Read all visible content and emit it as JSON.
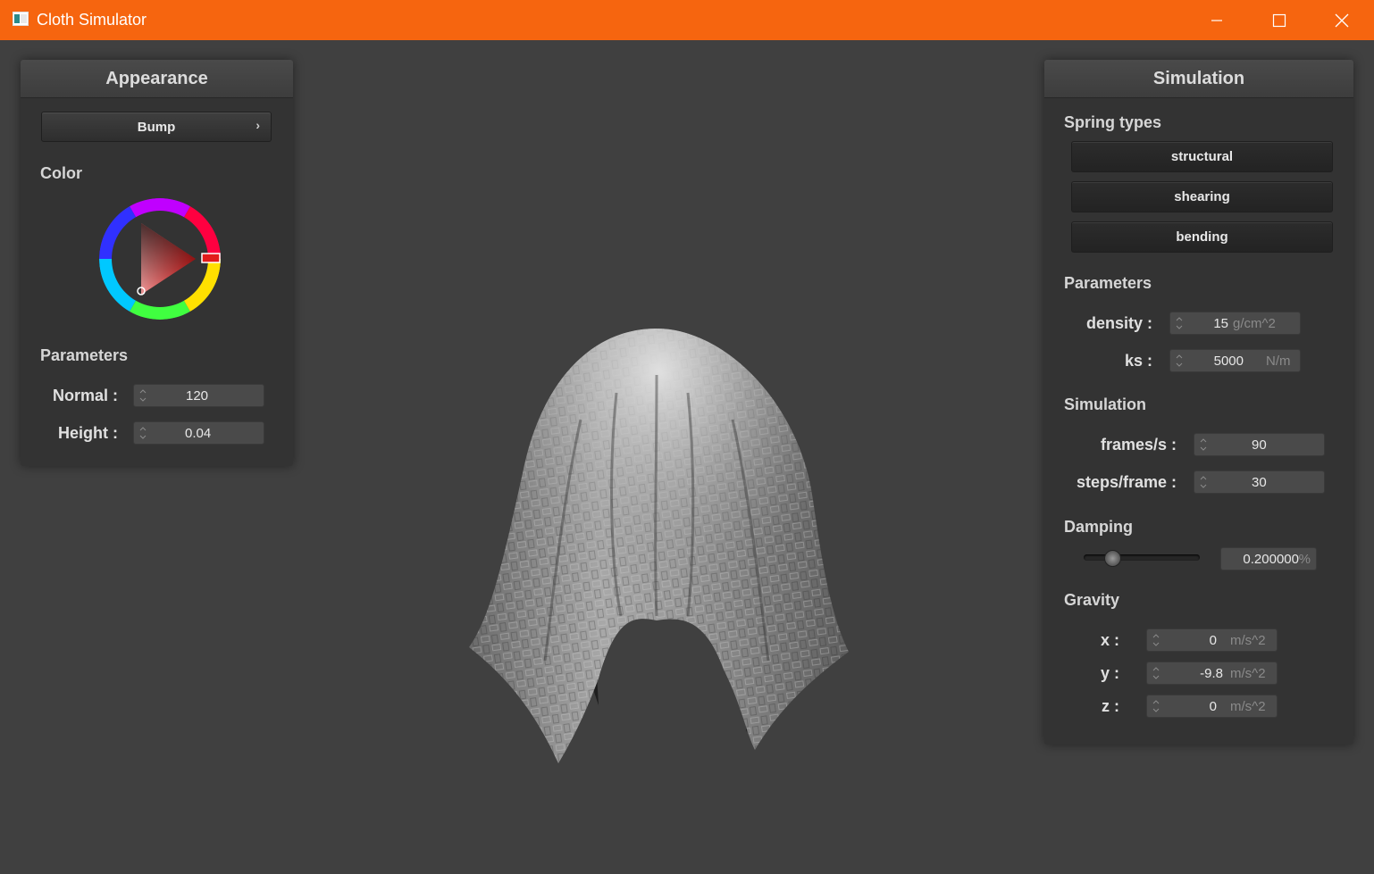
{
  "window": {
    "title": "Cloth Simulator",
    "accent": "#f6650f"
  },
  "appearance": {
    "title": "Appearance",
    "mode_button": "Bump",
    "color_label": "Color",
    "color_value": "#e21b1b",
    "parameters_label": "Parameters",
    "normal": {
      "label": "Normal :",
      "value": "120"
    },
    "height": {
      "label": "Height :",
      "value": "0.04"
    }
  },
  "simulation": {
    "title": "Simulation",
    "spring_types_label": "Spring types",
    "springs": [
      "structural",
      "shearing",
      "bending"
    ],
    "parameters_label": "Parameters",
    "density": {
      "label": "density :",
      "value": "15",
      "unit": "g/cm^2"
    },
    "ks": {
      "label": "ks :",
      "value": "5000",
      "unit": "N/m"
    },
    "simulation_label": "Simulation",
    "fps": {
      "label": "frames/s :",
      "value": "90"
    },
    "steps": {
      "label": "steps/frame :",
      "value": "30"
    },
    "damping_label": "Damping",
    "damping": {
      "value": "0.200000",
      "unit": "%",
      "slider_fraction": 0.2
    },
    "gravity_label": "Gravity",
    "gravity": [
      {
        "label": "x :",
        "value": "0",
        "unit": "m/s^2"
      },
      {
        "label": "y :",
        "value": "-9.8",
        "unit": "m/s^2"
      },
      {
        "label": "z :",
        "value": "0",
        "unit": "m/s^2"
      }
    ]
  }
}
